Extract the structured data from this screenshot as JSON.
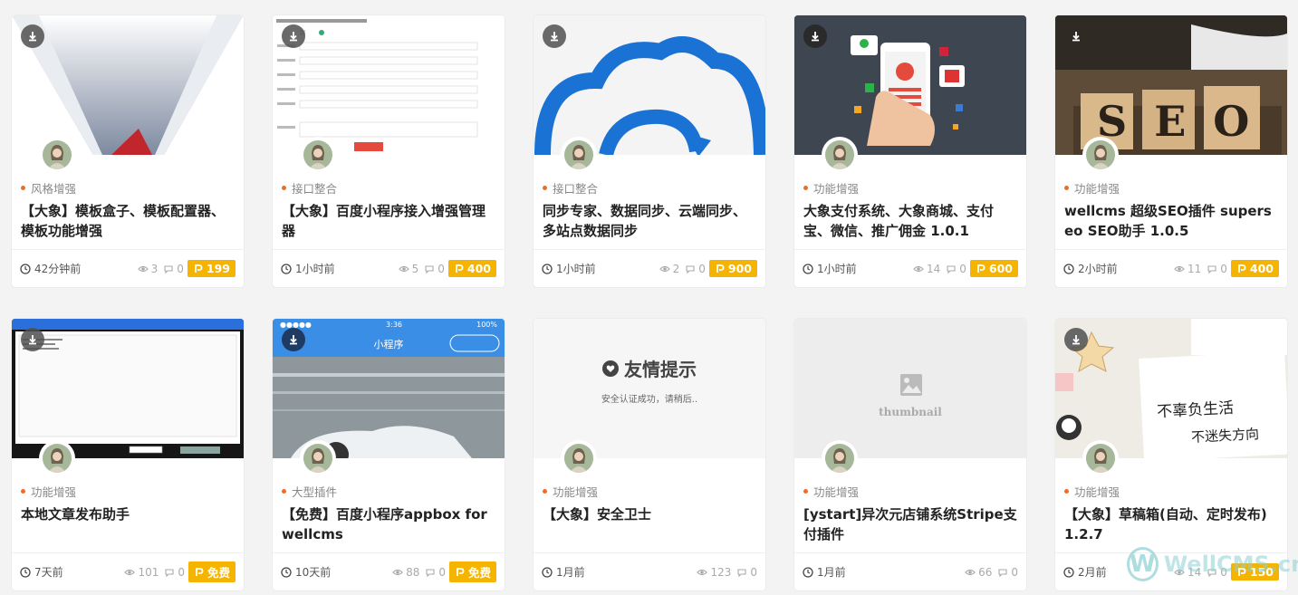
{
  "cards": [
    {
      "category": "风格增强",
      "title": "【大象】模板盒子、模板配置器、模板功能增强",
      "time": "42分钟前",
      "views": "3",
      "comments": "0",
      "price": "199"
    },
    {
      "category": "接口整合",
      "title": "【大象】百度小程序接入增强管理器",
      "time": "1小时前",
      "views": "5",
      "comments": "0",
      "price": "400"
    },
    {
      "category": "接口整合",
      "title": "同步专家、数据同步、云端同步、多站点数据同步",
      "time": "1小时前",
      "views": "2",
      "comments": "0",
      "price": "900"
    },
    {
      "category": "功能增强",
      "title": "大象支付系统、大象商城、支付宝、微信、推广佣金 1.0.1",
      "time": "1小时前",
      "views": "14",
      "comments": "0",
      "price": "600"
    },
    {
      "category": "功能增强",
      "title": "wellcms 超级SEO插件 superseo SEO助手 1.0.5",
      "time": "2小时前",
      "views": "11",
      "comments": "0",
      "price": "400"
    },
    {
      "category": "功能增强",
      "title": "本地文章发布助手",
      "time": "7天前",
      "views": "101",
      "comments": "0",
      "price": "免费"
    },
    {
      "category": "大型插件",
      "title": "【免费】百度小程序appbox for wellcms",
      "time": "10天前",
      "views": "88",
      "comments": "0",
      "price": "免费"
    },
    {
      "category": "功能增强",
      "title": "【大象】安全卫士",
      "time": "1月前",
      "views": "123",
      "comments": "0",
      "price": ""
    },
    {
      "category": "功能增强",
      "title": "[ystart]异次元店铺系统Stripe支付插件",
      "time": "1月前",
      "views": "66",
      "comments": "0",
      "price": ""
    },
    {
      "category": "功能增强",
      "title": "【大象】草稿箱(自动、定时发布) 1.2.7",
      "time": "2月前",
      "views": "14",
      "comments": "0",
      "price": "150"
    }
  ],
  "thumbs": {
    "seo_word": "SEO",
    "notice_title": "友情提示",
    "notice_text": "安全认证成功，请稍后..",
    "placeholder_text": "thumbnail",
    "miniapp_title": "小程序",
    "miniapp_time": "3:36",
    "miniapp_battery": "100%",
    "note_line1": "不辜负生活",
    "note_line2": "不迷失方向"
  },
  "watermark": {
    "letter": "W",
    "text": "WellCMS.cn"
  },
  "colors": {
    "accent": "#f26b21",
    "price": "#f5b400",
    "cloud": "#1a73d4"
  }
}
